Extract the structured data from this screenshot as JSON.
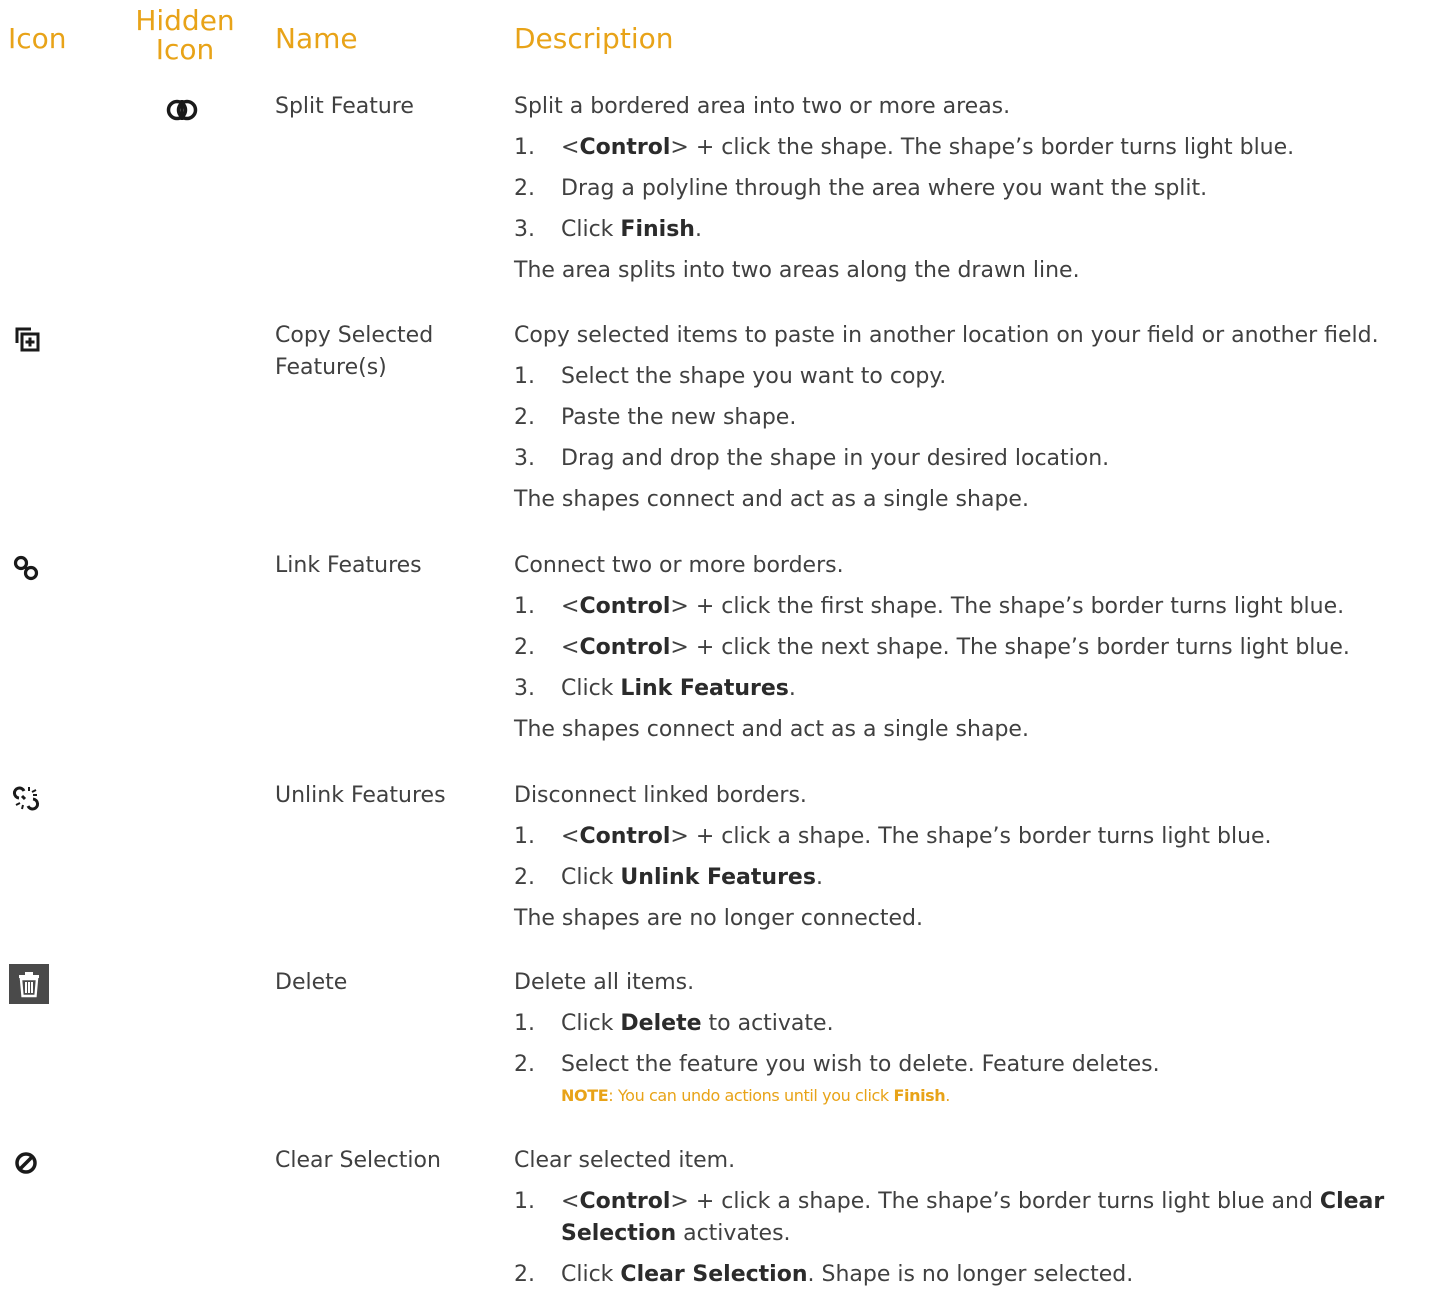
{
  "headers": {
    "icon": "Icon",
    "hidden_icon_line1": "Hidden",
    "hidden_icon_line2": "Icon",
    "name": "Name",
    "description": "Description"
  },
  "colors": {
    "accent": "#e8a318",
    "text": "#404040",
    "icon_dark": "#1a1a1a",
    "delete_icon_bg": "#4a4a4a"
  },
  "rows": [
    {
      "icon": "split-feature-icon",
      "name": "Split Feature",
      "intro": "Split a bordered area into two or more areas.",
      "steps": [
        {
          "num": "1.",
          "p1": "<",
          "b1": "Control",
          "p2": "> + click the shape. The shape’s border turns light blue."
        },
        {
          "num": "2.",
          "p1": "Drag a polyline through the area where you want the split."
        },
        {
          "num": "3.",
          "p1": "Click ",
          "b1": "Finish",
          "p2": "."
        }
      ],
      "result": "The area splits into two areas along the drawn line."
    },
    {
      "icon": "copy-feature-icon",
      "name_line1": "Copy Selected",
      "name_line2": "Feature(s)",
      "intro": "Copy selected items to paste in another location on your field or another field.",
      "steps": [
        {
          "num": "1.",
          "p1": "Select the shape you want to copy."
        },
        {
          "num": "2.",
          "p1": "Paste the new shape."
        },
        {
          "num": "3.",
          "p1": "Drag and drop the shape in your desired location."
        }
      ],
      "result": "The shapes connect and act as a single shape."
    },
    {
      "icon": "link-icon",
      "name": "Link Features",
      "intro": "Connect two or more borders.",
      "steps": [
        {
          "num": "1.",
          "p1": "<",
          "b1": "Control",
          "p2": "> + click the first shape. The shape’s border turns light blue."
        },
        {
          "num": "2.",
          "p1": "<",
          "b1": "Control",
          "p2": "> + click the next shape. The shape’s border turns light blue."
        },
        {
          "num": "3.",
          "p1": "Click ",
          "b1": "Link Features",
          "p2": "."
        }
      ],
      "result": "The shapes connect and act as a single shape."
    },
    {
      "icon": "unlink-icon",
      "name": "Unlink Features",
      "intro": "Disconnect linked borders.",
      "steps": [
        {
          "num": "1.",
          "p1": "<",
          "b1": "Control",
          "p2": "> + click a shape. The shape’s border turns light blue."
        },
        {
          "num": "2.",
          "p1": "Click ",
          "b1": "Unlink Features",
          "p2": "."
        }
      ],
      "result": "The shapes are no longer connected."
    },
    {
      "icon": "trash-icon",
      "name": "Delete",
      "intro": "Delete all items.",
      "steps": [
        {
          "num": "1.",
          "p1": "Click ",
          "b1": "Delete",
          "p2": " to activate."
        },
        {
          "num": "2.",
          "p1": "Select the feature you wish to delete. Feature deletes."
        }
      ],
      "note": {
        "b1": "NOTE",
        "p1": ": You can undo actions until you click ",
        "b2": "Finish",
        "p2": "."
      }
    },
    {
      "icon": "clear-selection-icon",
      "name": "Clear Selection",
      "intro": "Clear selected item.",
      "steps": [
        {
          "num": "1.",
          "p1": "<",
          "b1": "Control",
          "p2": "> + click a shape. The shape’s border turns light blue and ",
          "b2": "Clear Selection",
          "p3": " activates."
        },
        {
          "num": "2.",
          "p1": "Click ",
          "b1": "Clear Selection",
          "p2": ". Shape is no longer selected."
        }
      ]
    }
  ]
}
